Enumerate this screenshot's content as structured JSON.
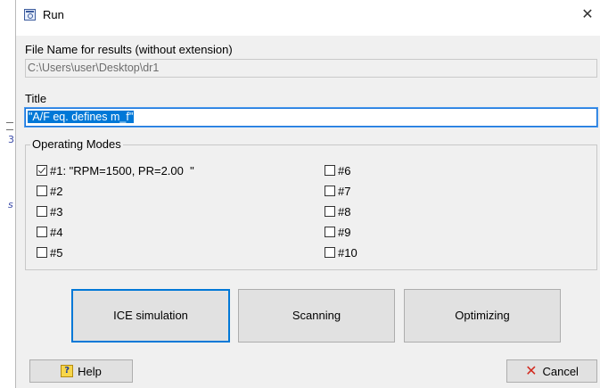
{
  "background": {
    "glyph_1": "3",
    "glyph_2": "s"
  },
  "window": {
    "title": "Run",
    "close_glyph": "✕"
  },
  "file_name": {
    "label": "File Name for results (without extension)",
    "value": "C:\\Users\\user\\Desktop\\dr1"
  },
  "title_field": {
    "label": "Title",
    "value": "\"A/F eq. defines m_f\""
  },
  "operating_modes": {
    "label": "Operating Modes",
    "modes": [
      {
        "label": "#1: \"RPM=1500, PR=2.00  \"",
        "checked": true
      },
      {
        "label": "#2",
        "checked": false
      },
      {
        "label": "#3",
        "checked": false
      },
      {
        "label": "#4",
        "checked": false
      },
      {
        "label": "#5",
        "checked": false
      },
      {
        "label": "#6",
        "checked": false
      },
      {
        "label": "#7",
        "checked": false
      },
      {
        "label": "#8",
        "checked": false
      },
      {
        "label": "#9",
        "checked": false
      },
      {
        "label": "#10",
        "checked": false
      }
    ]
  },
  "actions": {
    "ice_simulation": "ICE simulation",
    "scanning": "Scanning",
    "optimizing": "Optimizing"
  },
  "footer": {
    "help": "Help",
    "help_icon": "question-icon",
    "cancel": "Cancel",
    "cancel_icon": "close-x-icon"
  },
  "colors": {
    "selection": "#0078d7",
    "focus_border": "#0078d7",
    "cancel_icon": "#d22a1f",
    "dialog_bg": "#f0f0f0"
  }
}
